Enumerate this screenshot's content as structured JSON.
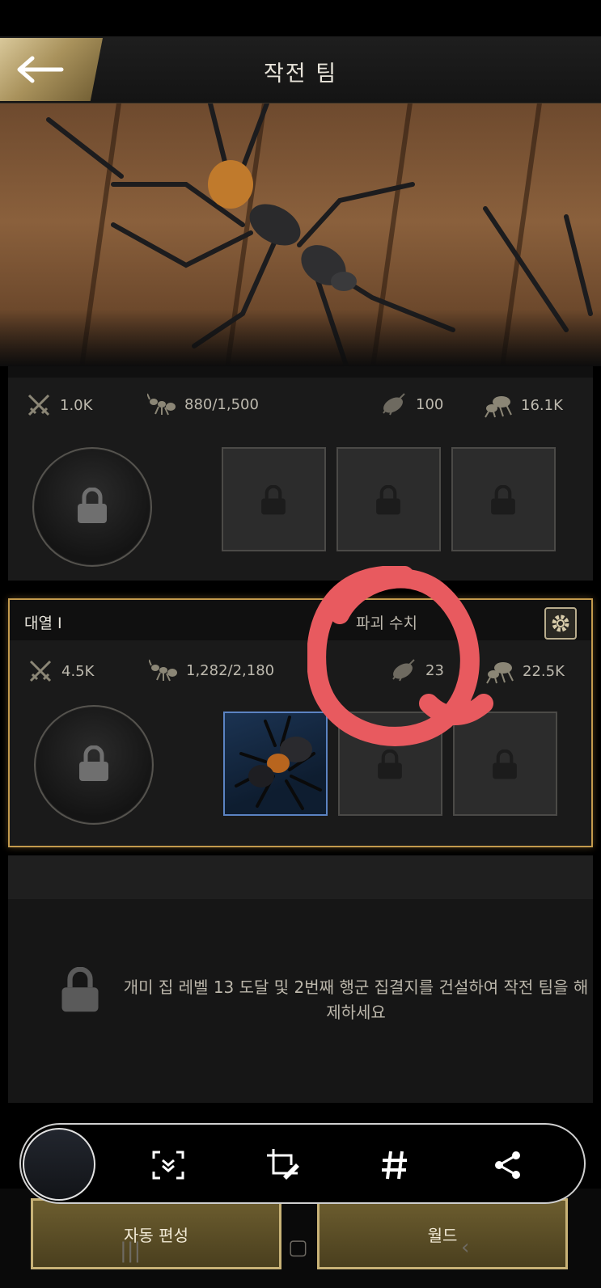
{
  "header": {
    "title": "작전 팀"
  },
  "team_top": {
    "stats": {
      "power": "1.0K",
      "troops": "880/1,500",
      "load": "100",
      "siege": "16.1K"
    }
  },
  "team_1": {
    "title": "대열 I",
    "sub_label": "파괴 수치",
    "stats": {
      "power": "4.5K",
      "troops": "1,282/2,180",
      "load": "23",
      "siege": "22.5K"
    }
  },
  "locked_team": {
    "message": "개미 집 레벨 13 도달 및 2번째 행군 집결지를 건설하여 작전 팀을 해제하세요"
  },
  "bottom_buttons": {
    "auto_compose": "자동 편성",
    "world": "월드"
  },
  "icons": {
    "back": "arrow-left-icon",
    "gear": "gear-icon",
    "lock": "lock-icon",
    "power": "crossed-swords-icon",
    "troops": "ant-icon",
    "load": "beetle-icon",
    "siege": "siege-ant-icon",
    "toolbar": [
      "scroll-capture-icon",
      "crop-edit-icon",
      "hashtag-icon",
      "share-icon"
    ]
  },
  "colors": {
    "accent_gold": "#c39a4d",
    "annotation_red": "#e85a5f",
    "selected_slot": "#5b83c2"
  }
}
